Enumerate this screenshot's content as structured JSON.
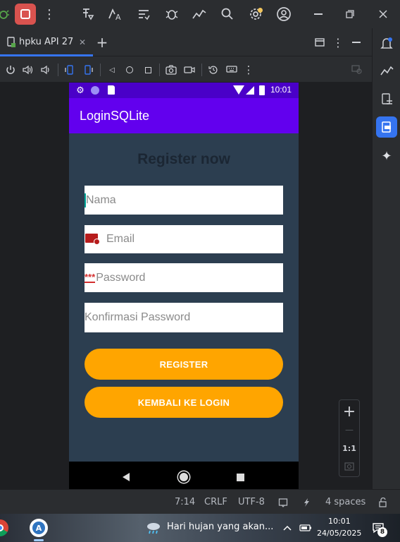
{
  "ide": {
    "tab_label": "hpku API 27",
    "add_tab_glyph": "+",
    "status": {
      "position": "7:14",
      "line_endings": "CRLF",
      "encoding": "UTF-8",
      "indent": "4 spaces"
    },
    "zoom_controls": {
      "plus": "+",
      "minus": "—",
      "ratio": "1:1"
    },
    "colors": {
      "accent_stop": "#d9534f",
      "active_tool": "#3574f0",
      "dot_warning": "#f2c55c"
    }
  },
  "phone": {
    "status_time": "10:01",
    "app_title": "LoginSQLite",
    "heading": "Register now",
    "fields": {
      "nama_placeholder": "Nama",
      "email_placeholder": "Email",
      "password_placeholder": "Password",
      "password_prefix": "***",
      "confirm_placeholder": "Konfirmasi Password"
    },
    "buttons": {
      "register": "REGISTER",
      "back_to_login": "KEMBALI KE LOGIN"
    },
    "colors": {
      "status_bar": "#4a00c8",
      "app_bar": "#6200ee",
      "background": "#2c3e50",
      "button": "#ffa500"
    }
  },
  "taskbar": {
    "weather_text": "Hari hujan yang akan...",
    "time": "10:01",
    "date": "24/05/2025",
    "notification_count": "8"
  }
}
